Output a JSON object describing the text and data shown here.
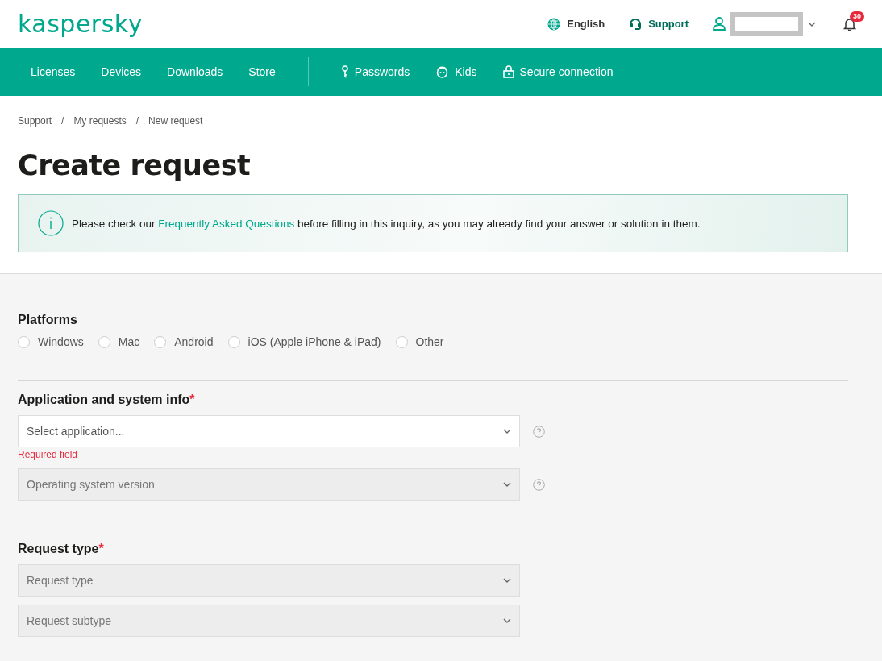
{
  "header": {
    "logo": "kaspersky",
    "language": "English",
    "support": "Support",
    "notifications": "30"
  },
  "nav": {
    "items": [
      {
        "label": "Licenses",
        "kind": "plain"
      },
      {
        "label": "Devices",
        "kind": "plain"
      },
      {
        "label": "Downloads",
        "kind": "plain"
      },
      {
        "label": "Store",
        "kind": "plain"
      },
      {
        "label": "Passwords",
        "kind": "key"
      },
      {
        "label": "Kids",
        "kind": "kid"
      },
      {
        "label": "Secure connection",
        "kind": "lock"
      }
    ]
  },
  "breadcrumbs": [
    "Support",
    "My requests",
    "New request"
  ],
  "breadcrumb_separator": "/",
  "title": "Create request",
  "notice": {
    "before": "Please check our ",
    "link": "Frequently Asked Questions",
    "after": " before filling in this inquiry, as you may already find your answer or solution in them."
  },
  "sections": [
    {
      "title": "Platforms",
      "kind": "radios",
      "options": [
        {
          "label": "Windows",
          "selected": false
        },
        {
          "label": "Mac",
          "selected": false
        },
        {
          "label": "Android",
          "selected": false
        },
        {
          "label": "iOS (Apple iPhone & iPad)",
          "selected": false
        },
        {
          "label": "Other",
          "selected": false
        }
      ]
    },
    {
      "title": "Application and system info",
      "required_mark": "*",
      "kind": "selects",
      "fields": [
        {
          "placeholder": "Select application...",
          "disabled": false,
          "help": true,
          "error": "Required field"
        },
        {
          "placeholder": "Operating system version",
          "disabled": true,
          "help": true
        }
      ]
    },
    {
      "title": "Request type",
      "required_mark": "*",
      "kind": "selects",
      "fields": [
        {
          "placeholder": "Request type",
          "disabled": true,
          "help": false
        },
        {
          "placeholder": "Request subtype",
          "disabled": true,
          "help": false
        }
      ]
    }
  ]
}
